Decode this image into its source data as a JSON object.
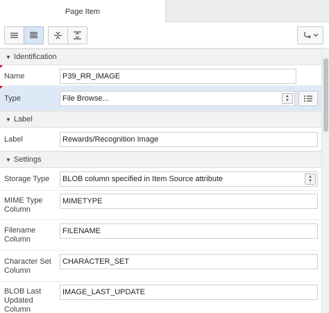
{
  "tabs": {
    "active": "Page Item"
  },
  "sections": {
    "identification": {
      "title": "Identification",
      "name_label": "Name",
      "name_value": "P39_RR_IMAGE",
      "type_label": "Type",
      "type_value": "File Browse..."
    },
    "label": {
      "title": "Label",
      "label_label": "Label",
      "label_value": "Rewards/Recognition Image"
    },
    "settings": {
      "title": "Settings",
      "storage_type_label": "Storage Type",
      "storage_type_value": "BLOB column specified in Item Source attribute",
      "mime_label": "MIME Type Column",
      "mime_value": "MIMETYPE",
      "filename_label": "Filename Column",
      "filename_value": "FILENAME",
      "charset_label": "Character Set Column",
      "charset_value": "CHARACTER_SET",
      "blob_label": "BLOB Last Updated Column",
      "blob_value": "IMAGE_LAST_UPDATE"
    }
  },
  "colors": {
    "highlight": "#dde9f7",
    "required": "#d0021b",
    "active_button": "#d9e6f5"
  }
}
